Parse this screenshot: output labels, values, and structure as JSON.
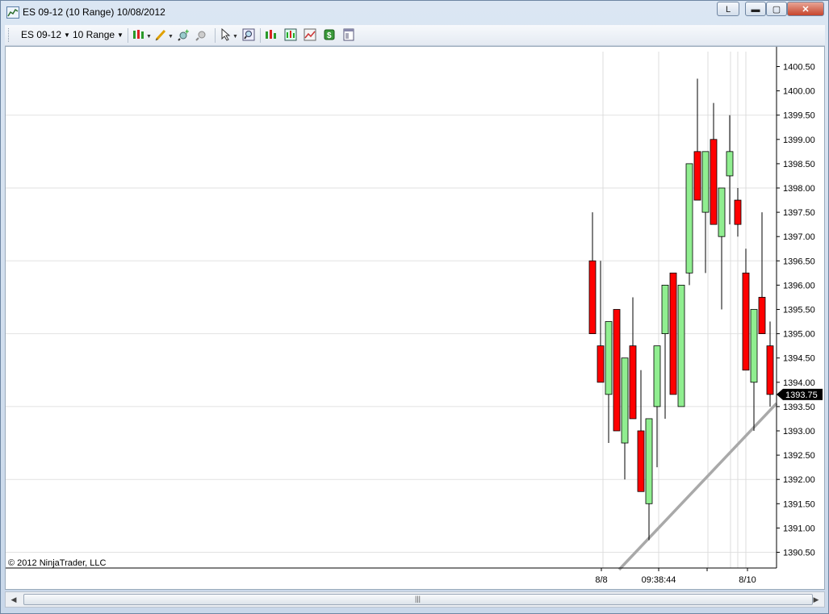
{
  "window": {
    "title": "ES 09-12 (10 Range)  10/08/2012",
    "btn_l": "L",
    "btn_min": "▬",
    "btn_max": "▢",
    "btn_close": "✕"
  },
  "toolbar": {
    "instrument": "ES 09-12",
    "interval": "10 Range"
  },
  "icons": [
    "chart-icon",
    "candlestick-style-icon",
    "pencil-draw-icon",
    "zoom-in-icon",
    "zoom-out-icon",
    "pointer-icon",
    "magnifier-icon",
    "bars-icon",
    "indicators-icon",
    "strategy-icon",
    "money-icon",
    "properties-icon"
  ],
  "colors": {
    "up": "#90ee90",
    "down": "#ff0000",
    "trend": "#a9a9a9",
    "last_price_bg": "#000000"
  },
  "footer": {
    "copyright": "© 2012 NinjaTrader, LLC"
  },
  "chart_data": {
    "type": "candlestick",
    "ylim": [
      1390.25,
      1400.75
    ],
    "y_ticks": [
      "1390.50",
      "1391.00",
      "1391.50",
      "1392.00",
      "1392.50",
      "1393.00",
      "1393.50",
      "1394.00",
      "1394.50",
      "1395.00",
      "1395.50",
      "1396.00",
      "1396.50",
      "1397.00",
      "1397.50",
      "1398.00",
      "1398.50",
      "1399.00",
      "1399.50",
      "1400.00",
      "1400.50"
    ],
    "x_labels": [
      "8/8",
      "09:38:44",
      "8/10"
    ],
    "last_price": "1393.75",
    "bars": [
      {
        "o": 1396.5,
        "h": 1397.5,
        "l": 1395.0,
        "c": 1395.0
      },
      {
        "o": 1394.75,
        "h": 1396.5,
        "l": 1394.0,
        "c": 1394.0
      },
      {
        "o": 1393.75,
        "h": 1395.25,
        "l": 1392.75,
        "c": 1395.25
      },
      {
        "o": 1395.5,
        "h": 1395.5,
        "l": 1393.0,
        "c": 1393.0
      },
      {
        "o": 1392.75,
        "h": 1394.5,
        "l": 1392.0,
        "c": 1394.5
      },
      {
        "o": 1394.75,
        "h": 1395.75,
        "l": 1393.25,
        "c": 1393.25
      },
      {
        "o": 1393.0,
        "h": 1394.25,
        "l": 1391.75,
        "c": 1391.75
      },
      {
        "o": 1391.5,
        "h": 1393.25,
        "l": 1390.75,
        "c": 1393.25
      },
      {
        "o": 1393.5,
        "h": 1394.75,
        "l": 1392.25,
        "c": 1394.75
      },
      {
        "o": 1395.0,
        "h": 1396.0,
        "l": 1393.25,
        "c": 1396.0
      },
      {
        "o": 1396.25,
        "h": 1396.25,
        "l": 1393.75,
        "c": 1393.75
      },
      {
        "o": 1393.5,
        "h": 1396.0,
        "l": 1393.5,
        "c": 1396.0
      },
      {
        "o": 1396.25,
        "h": 1398.5,
        "l": 1396.0,
        "c": 1398.5
      },
      {
        "o": 1398.75,
        "h": 1400.25,
        "l": 1397.75,
        "c": 1397.75
      },
      {
        "o": 1397.5,
        "h": 1398.75,
        "l": 1396.25,
        "c": 1398.75
      },
      {
        "o": 1399.0,
        "h": 1399.75,
        "l": 1397.25,
        "c": 1397.25
      },
      {
        "o": 1397.0,
        "h": 1398.0,
        "l": 1395.5,
        "c": 1398.0
      },
      {
        "o": 1398.25,
        "h": 1399.5,
        "l": 1397.25,
        "c": 1398.75
      },
      {
        "o": 1397.75,
        "h": 1398.0,
        "l": 1397.0,
        "c": 1397.25
      },
      {
        "o": 1396.25,
        "h": 1396.75,
        "l": 1394.25,
        "c": 1394.25
      },
      {
        "o": 1394.0,
        "h": 1395.5,
        "l": 1393.0,
        "c": 1395.5
      },
      {
        "o": 1395.75,
        "h": 1397.5,
        "l": 1395.0,
        "c": 1395.0
      },
      {
        "o": 1394.75,
        "h": 1395.25,
        "l": 1393.5,
        "c": 1393.75
      }
    ],
    "trendline": {
      "from": [
        1390.25
      ],
      "to": [
        1393.5
      ]
    }
  }
}
